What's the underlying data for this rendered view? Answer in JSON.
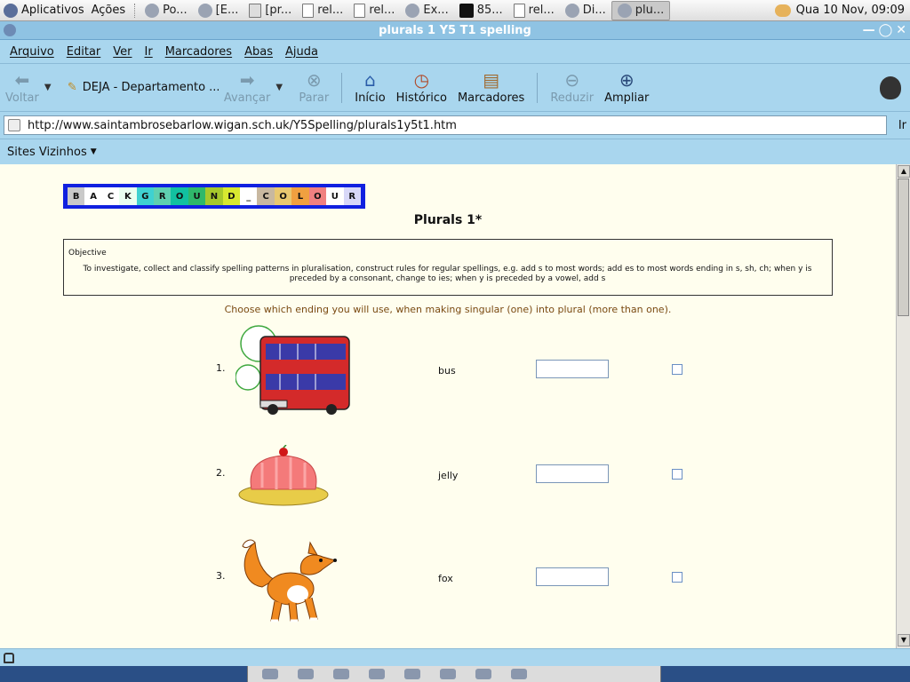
{
  "panel": {
    "applications": "Aplicativos",
    "actions": "Ações",
    "tasks": [
      {
        "label": "Po...",
        "icon": "browser-icon"
      },
      {
        "label": "[E...",
        "icon": "browser-icon"
      },
      {
        "label": "[pr...",
        "icon": "spreadsheet-icon"
      },
      {
        "label": "rel...",
        "icon": "document-icon"
      },
      {
        "label": "rel...",
        "icon": "document-icon"
      },
      {
        "label": "Ex...",
        "icon": "browser-icon"
      },
      {
        "label": "85...",
        "icon": "camera-icon"
      },
      {
        "label": "rel...",
        "icon": "document-icon"
      },
      {
        "label": "Di...",
        "icon": "browser-icon"
      },
      {
        "label": "plu...",
        "icon": "browser-icon"
      }
    ],
    "clock": "Qua 10 Nov, 09:09"
  },
  "window": {
    "title": "plurals 1 Y5 T1 spelling"
  },
  "menubar": [
    "Arquivo",
    "Editar",
    "Ver",
    "Ir",
    "Marcadores",
    "Abas",
    "Ajuda"
  ],
  "toolbar": {
    "back": "Voltar",
    "bookmark_chip": "DEJA - Departamento ...",
    "forward": "Avançar",
    "stop": "Parar",
    "home": "Início",
    "history": "Histórico",
    "bookmarks": "Marcadores",
    "zoom_out": "Reduzir",
    "zoom_in": "Ampliar"
  },
  "location": {
    "url": "http://www.saintambrosebarlow.wigan.sch.uk/Y5Spelling/plurals1y5t1.htm",
    "go": "Ir"
  },
  "sites": {
    "label": "Sites Vizinhos"
  },
  "page": {
    "bg_colour_letters": [
      {
        "char": "B",
        "color": "#c9c9c9"
      },
      {
        "char": "A",
        "color": "#ffffff"
      },
      {
        "char": "C",
        "color": "#ffffff"
      },
      {
        "char": "K",
        "color": "#e9fff0"
      },
      {
        "char": "G",
        "color": "#3fd1d1"
      },
      {
        "char": "R",
        "color": "#5fd0b0"
      },
      {
        "char": "O",
        "color": "#12c0a0"
      },
      {
        "char": "U",
        "color": "#2fb86a"
      },
      {
        "char": "N",
        "color": "#a6c82c"
      },
      {
        "char": "D",
        "color": "#d8e830"
      },
      {
        "char": "_",
        "color": "#ffffff"
      },
      {
        "char": "C",
        "color": "#c8b8a0"
      },
      {
        "char": "O",
        "color": "#e8c870"
      },
      {
        "char": "L",
        "color": "#f0a040"
      },
      {
        "char": "O",
        "color": "#f08080"
      },
      {
        "char": "U",
        "color": "#ffffff"
      },
      {
        "char": "R",
        "color": "#d8d8f8"
      }
    ],
    "title": "Plurals 1*",
    "objective_heading": "Objective",
    "objective_text": "To investigate, collect and classify spelling patterns in pluralisation, construct rules for regular spellings, e.g. add s to most words; add es to most words ending in s, sh, ch; when y is preceded by a consonant, change to ies; when y is preceded by a vowel, add s",
    "instruction": "Choose which ending you will use, when making singular (one) into plural (more than one).",
    "questions": [
      {
        "num": "1.",
        "word": "bus",
        "image": "bus-picture",
        "answer": ""
      },
      {
        "num": "2.",
        "word": "jelly",
        "image": "jelly-picture",
        "answer": ""
      },
      {
        "num": "3.",
        "word": "fox",
        "image": "fox-picture",
        "answer": ""
      }
    ]
  }
}
